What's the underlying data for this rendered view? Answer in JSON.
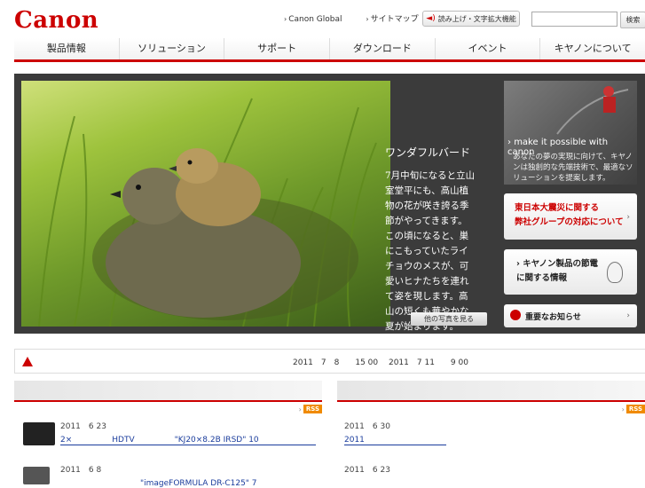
{
  "header": {
    "logo": "Canon",
    "links": [
      "Canon Global",
      "サイトマップ"
    ],
    "access_button": "読み上げ・文字拡大機能",
    "search_placeholder": "",
    "search_button": "検索"
  },
  "nav": [
    "製品情報",
    "ソリューション",
    "サポート",
    "ダウンロード",
    "イベント",
    "キヤノンについて"
  ],
  "hero": {
    "title": "ワンダフルバード",
    "body": "7月中旬になると立山室堂平にも、高山植物の花が咲き誇る季節がやってきます。この頃になると、巣にこもっていたライチョウのメスが、可愛いヒナたちを連れて姿を現します。高山の短くも華やかな夏が始まります。",
    "more_button": "他の写真を見る"
  },
  "side": {
    "banner_title": "make it possible with canon",
    "banner_text": "あなたの夢の実現に向けて、キヤノンは独創的な先端技術で、最適なソリューションを提案します。",
    "box1": [
      "東日本大震災に関する",
      "弊社グループの対応について"
    ],
    "box2": [
      "キヤノン製品の節電",
      "に関する情報"
    ],
    "box3": "重要なお知らせ"
  },
  "notice": {
    "text": "2011　7　8　　15 00　 2011　7 11　　9 00"
  },
  "news": {
    "left": {
      "rss": "RSS",
      "items": [
        {
          "date": "2011　6 23",
          "link": "2×　　　　　HDTV　　　　　\"KJ20×8.2B IRSD\" 10　　　　　"
        },
        {
          "date": "2011　6 8",
          "link": "　　　　　　　　　　\"imageFORMULA DR-C125\" 7"
        }
      ]
    },
    "right": {
      "rss": "RSS",
      "items": [
        {
          "date": "2011　6 30",
          "link": "2011　　　　　　　　　　　"
        },
        {
          "date": "2011　6 23",
          "link": ""
        }
      ]
    }
  },
  "colors": {
    "brand_red": "#cc0000",
    "link_blue": "#1a3c9c",
    "rss_orange": "#f08a00"
  }
}
